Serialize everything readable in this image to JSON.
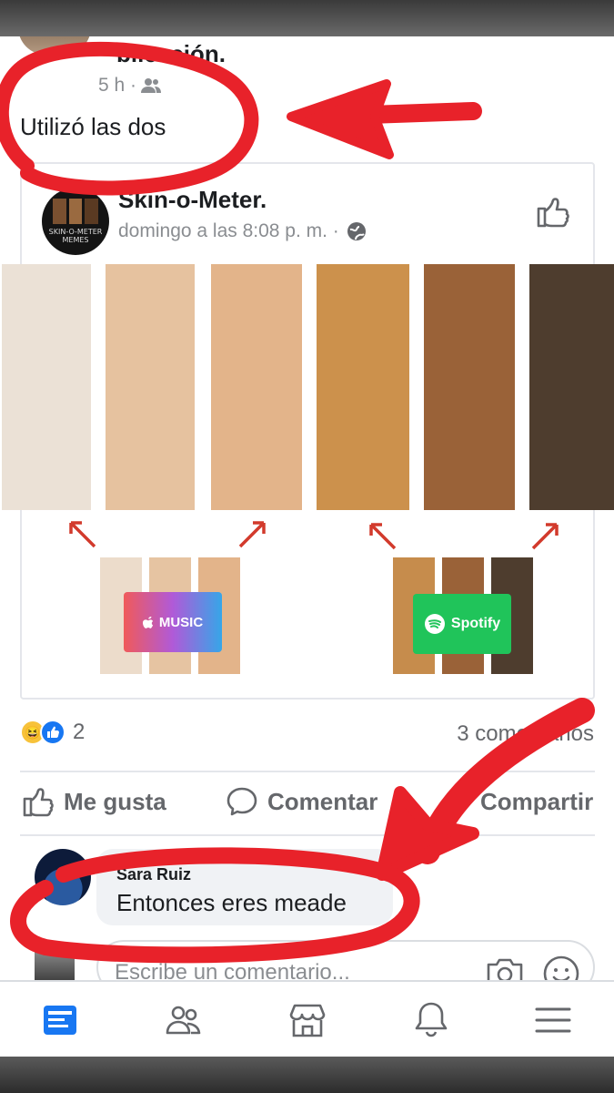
{
  "post": {
    "cut_text": "blicación.",
    "time": "5 h ·",
    "text": "Utilizó las dos"
  },
  "shared": {
    "page_name": "Skin-o-Meter.",
    "time": "domingo a las 8:08 p. m. ·",
    "avatar_text": "SKIN-O-METER MEMES",
    "swatch_colors": [
      "#ebe1d6",
      "#e6c29f",
      "#e3b48a",
      "#cc914c",
      "#9a6238",
      "#4e3d2e"
    ],
    "apple_badge": "MUSIC",
    "spotify_badge": "Spotify"
  },
  "stats": {
    "reaction_count": "2",
    "comments": "3 comentarios"
  },
  "actions": {
    "like": "Me gusta",
    "comment": "Comentar",
    "share": "Compartir"
  },
  "comment": {
    "author": "Sara Ruiz",
    "text": "Entonces eres meade"
  },
  "composer": {
    "placeholder": "Escribe un comentario..."
  },
  "colors": {
    "accent": "#1877f2",
    "annotation": "#e8222a"
  },
  "icons": [
    "friends-icon",
    "globe-icon",
    "like-icon",
    "comment-icon",
    "share-icon",
    "camera-icon",
    "emoji-icon",
    "feed-icon",
    "marketplace-icon",
    "bell-icon",
    "menu-icon"
  ]
}
